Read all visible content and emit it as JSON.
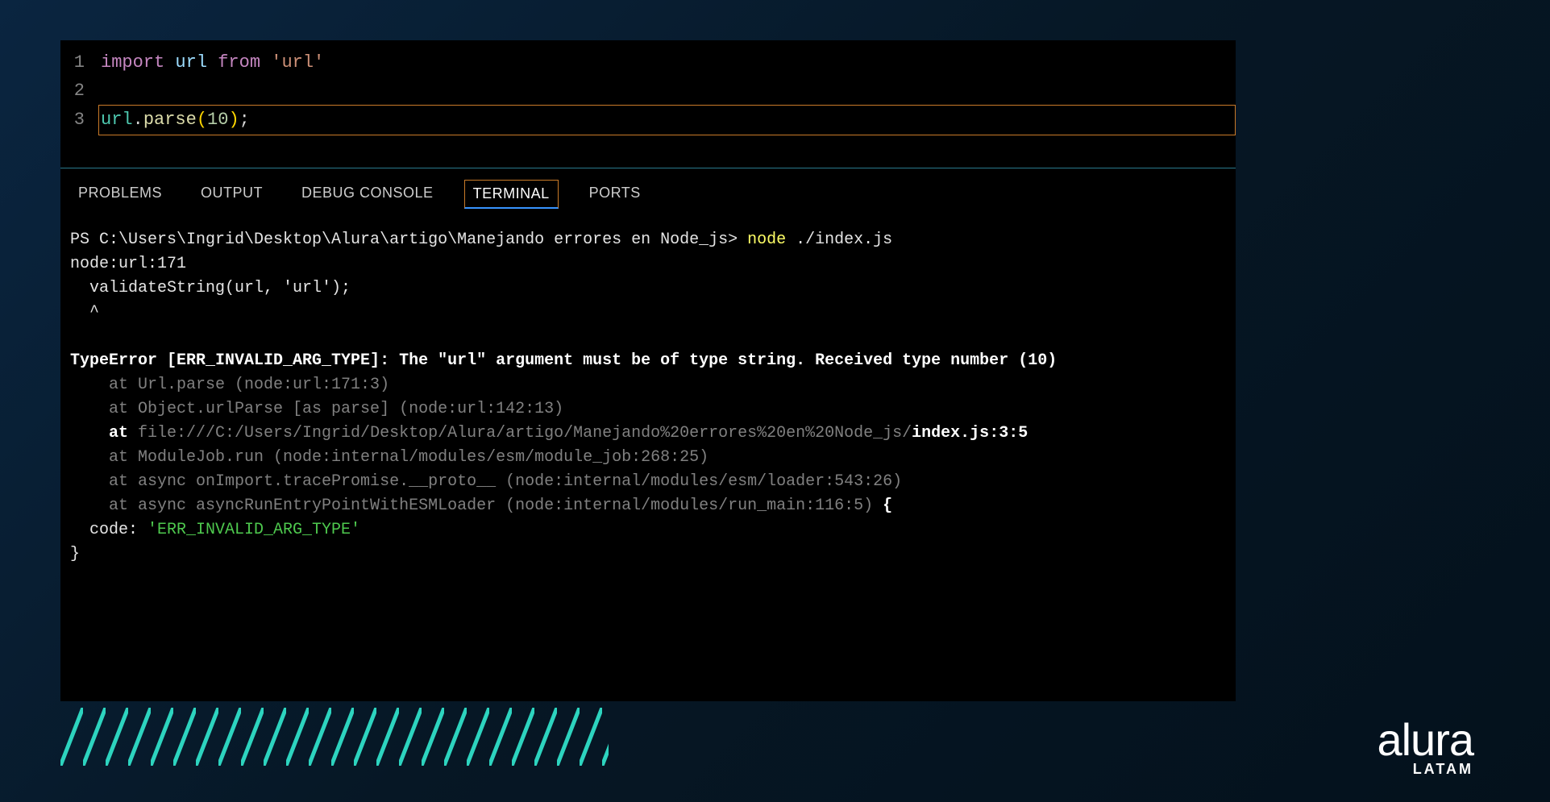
{
  "editor": {
    "lines": {
      "1": {
        "num": "1"
      },
      "2": {
        "num": "2"
      },
      "3": {
        "num": "3"
      }
    },
    "tokens": {
      "import": "import",
      "url_var": "url",
      "from": "from",
      "url_str": "'url'",
      "url_obj": "url",
      "dot": ".",
      "parse": "parse",
      "lparen": "(",
      "ten": "10",
      "rparen": ")",
      "semi": ";"
    }
  },
  "tabs": {
    "problems": "PROBLEMS",
    "output": "OUTPUT",
    "debug": "DEBUG CONSOLE",
    "terminal": "TERMINAL",
    "ports": "PORTS"
  },
  "terminal": {
    "prompt": "PS C:\\Users\\Ingrid\\Desktop\\Alura\\artigo\\Manejando errores en Node_js> ",
    "command_node": "node ",
    "command_arg": "./index.js",
    "line_nodeurl": "node:url:171",
    "line_validate": "  validateString(url, 'url');",
    "line_caret": "  ^",
    "error_head": "TypeError [ERR_INVALID_ARG_TYPE]: The \"url\" argument must be of type string. Received type number (10)",
    "stack1": "    at Url.parse (node:url:171:3)",
    "stack2": "    at Object.urlParse [as parse] (node:url:142:13)",
    "stack3_at": "    at ",
    "stack3_path": "file:///C:/Users/Ingrid/Desktop/Alura/artigo/Manejando%20errores%20en%20Node_js/",
    "stack3_file": "index.js:3:5",
    "stack4": "    at ModuleJob.run (node:internal/modules/esm/module_job:268:25)",
    "stack5": "    at async onImport.tracePromise.__proto__ (node:internal/modules/esm/loader:543:26)",
    "stack6": "    at async asyncRunEntryPointWithESMLoader (node:internal/modules/run_main:116:5) ",
    "stack6_brace": "{",
    "code_label": "  code: ",
    "code_value": "'ERR_INVALID_ARG_TYPE'",
    "close_brace": "}"
  },
  "logo": {
    "brand": "alura",
    "sub": "LATAM"
  }
}
